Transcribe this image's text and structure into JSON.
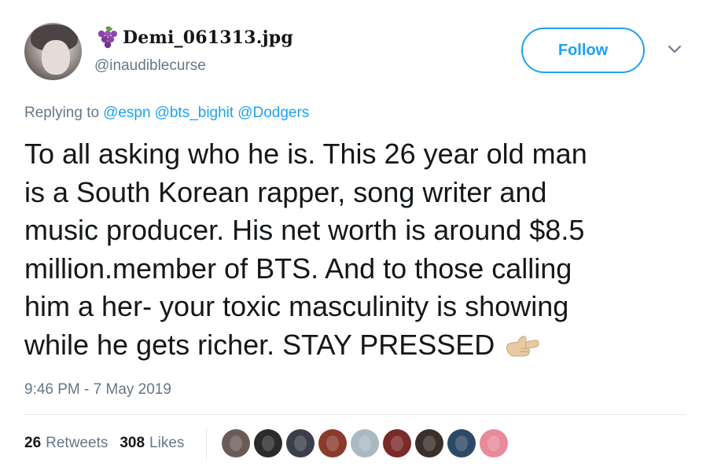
{
  "user": {
    "display_name": "Demi_061313.jpg",
    "handle": "@inaudiblecurse",
    "name_icon": "grape-icon"
  },
  "follow_button": {
    "label": "Follow"
  },
  "replying": {
    "prefix": "Replying to",
    "mentions": [
      "@espn",
      "@bts_bighit",
      "@Dodgers"
    ]
  },
  "tweet": {
    "lines": [
      "To all asking who he is. This 26 year old man",
      "is a South Korean rapper, song writer and",
      "music producer. His net worth is around $8.5",
      "million.member of BTS. And to those calling",
      "him a her- your toxic masculinity is showing",
      "while he gets richer. STAY PRESSED"
    ],
    "emoji": "call-me-hand-emoji"
  },
  "timestamp": "9:46 PM - 7 May 2019",
  "stats": {
    "retweets_count": "26",
    "retweets_label": "Retweets",
    "likes_count": "308",
    "likes_label": "Likes"
  },
  "likers": [
    {
      "color": "#6b5b57"
    },
    {
      "color": "#2b2b2b"
    },
    {
      "color": "#3a3f4a"
    },
    {
      "color": "#8a3b2c"
    },
    {
      "color": "#aab8c2"
    },
    {
      "color": "#7a2a2a"
    },
    {
      "color": "#3a2f2a"
    },
    {
      "color": "#2c4a66"
    },
    {
      "color": "#e88a9a"
    }
  ],
  "colors": {
    "accent": "#1da1f2",
    "secondary_text": "#657786",
    "primary_text": "#14171a",
    "divider": "#e1e8ed"
  }
}
